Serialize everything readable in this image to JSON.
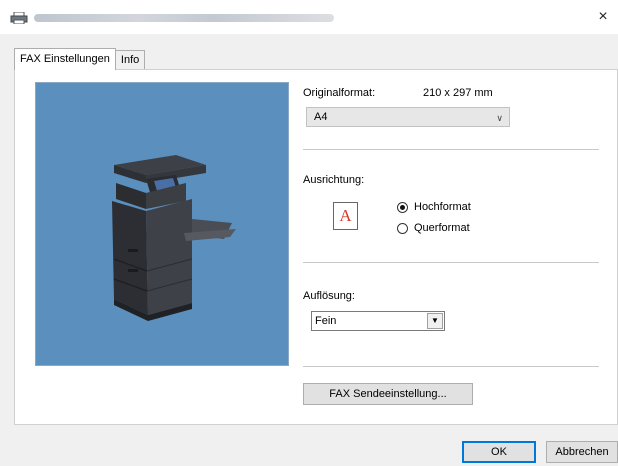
{
  "window": {
    "close_glyph": "×",
    "icon": "printer-icon"
  },
  "tabs": [
    {
      "label": "FAX Einstellungen",
      "active": true
    },
    {
      "label": "Info",
      "active": false
    }
  ],
  "original_format": {
    "label": "Originalformat:",
    "size": "210 x 297 mm",
    "selected": "A4"
  },
  "orientation": {
    "label": "Ausrichtung:",
    "icon_letter": "A",
    "options": [
      {
        "label": "Hochformat",
        "checked": true
      },
      {
        "label": "Querformat",
        "checked": false
      }
    ]
  },
  "resolution": {
    "label": "Auflösung:",
    "selected": "Fein"
  },
  "buttons": {
    "fax_send_settings": "FAX Sendeeinstellung...",
    "ok": "OK",
    "cancel": "Abbrechen"
  },
  "colors": {
    "preview_bg": "#5b8fbd",
    "accent": "#0078d7",
    "icon_letter": "#d43c2c"
  }
}
